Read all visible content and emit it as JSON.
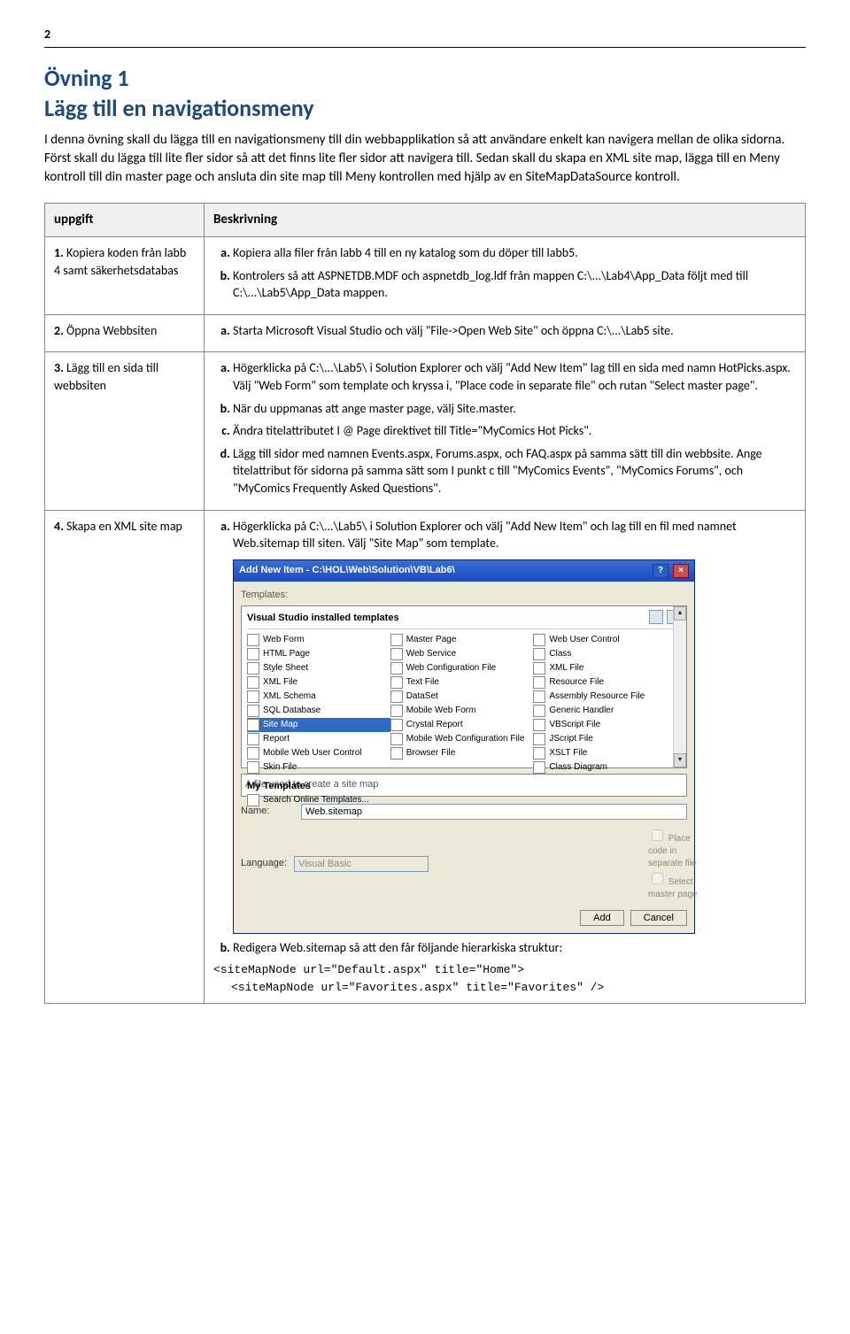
{
  "page_number": "2",
  "heading": "Övning 1",
  "subtitle": "Lägg till en navigationsmeny",
  "intro": "I denna övning skall du lägga till en navigationsmeny till din webbapplikation så att användare enkelt kan navigera mellan de olika sidorna. Först skall du lägga till lite fler sidor så att det finns lite fler sidor att navigera till. Sedan skall du skapa en XML site map, lägga till en Meny kontroll till din master page och ansluta din site map till Meny kontrollen med hjälp av en SiteMapDataSource kontroll.",
  "table": {
    "headers": {
      "task": "uppgift",
      "desc": "Beskrivning"
    },
    "rows": [
      {
        "num": "1.",
        "task": "Kopiera koden från labb 4 samt säkerhetsdatabas",
        "items": [
          "Kopiera alla filer från labb 4 till en ny katalog som du döper till labb5.",
          "Kontrolers så att ASPNETDB.MDF och aspnetdb_log.ldf från mappen C:\\...\\Lab4\\App_Data följt med till C:\\...\\Lab5\\App_Data mappen."
        ]
      },
      {
        "num": "2.",
        "task": "Öppna Webbsiten",
        "items": [
          "Starta Microsoft Visual Studio och välj \"File->Open Web Site\" och öppna C:\\...\\Lab5 site."
        ]
      },
      {
        "num": "3.",
        "task": "Lägg till en sida till webbsiten",
        "items": [
          "Högerklicka på C:\\...\\Lab5\\ i Solution Explorer och välj \"Add New Item\" lag till en sida med namn HotPicks.aspx. Välj \"Web Form\" som template och kryssa i, \"Place code in separate file\" och rutan \"Select master page\".",
          "När du uppmanas att ange master page, välj Site.master.",
          "Ändra titelattributet I @ Page direktivet till Title=\"MyComics Hot Picks\".",
          "Lägg till sidor med namnen Events.aspx, Forums.aspx, och FAQ.aspx på samma sätt till din webbsite. Ange titelattribut för sidorna på samma sätt som I punkt c till \"MyComics Events\", \"MyComics Forums\", och \"MyComics Frequently Asked Questions\"."
        ]
      },
      {
        "num": "4.",
        "task": "Skapa en XML site map",
        "items_a": "Högerklicka på C:\\...\\Lab5\\ i Solution Explorer och välj \"Add New Item\" och lag till en fil med namnet Web.sitemap till siten. Välj \"Site Map\" som template.",
        "items_b": "Redigera Web.sitemap så att den får följande hierarkiska struktur:",
        "code_line1": "<siteMapNode url=\"Default.aspx\" title=\"Home\">",
        "code_line2": "<siteMapNode url=\"Favorites.aspx\" title=\"Favorites\" />"
      }
    ]
  },
  "dialog": {
    "title": "Add New Item - C:\\HOL\\Web\\Solution\\VB\\Lab6\\",
    "templates_label": "Templates:",
    "installed_header": "Visual Studio installed templates",
    "cols": [
      [
        "Web Form",
        "HTML Page",
        "Style Sheet",
        "XML File",
        "XML Schema",
        "SQL Database",
        "Site Map",
        "Report",
        "Mobile Web User Control",
        "Skin File"
      ],
      [
        "Master Page",
        "Web Service",
        "Web Configuration File",
        "Text File",
        "DataSet",
        "Mobile Web Form",
        "Crystal Report",
        "Mobile Web Configuration File",
        "Browser File"
      ],
      [
        "Web User Control",
        "Class",
        "XML File",
        "Resource File",
        "Assembly Resource File",
        "Generic Handler",
        "VBScript File",
        "JScript File",
        "XSLT File",
        "Class Diagram"
      ]
    ],
    "my_templates": "My Templates",
    "search_online": "Search Online Templates...",
    "desc": "A file used to create a site map",
    "name_label": "Name:",
    "name_value": "Web.sitemap",
    "lang_label": "Language:",
    "lang_value": "Visual Basic",
    "chk1": "Place code in separate file",
    "chk2": "Select master page",
    "btn_add": "Add",
    "btn_cancel": "Cancel"
  }
}
